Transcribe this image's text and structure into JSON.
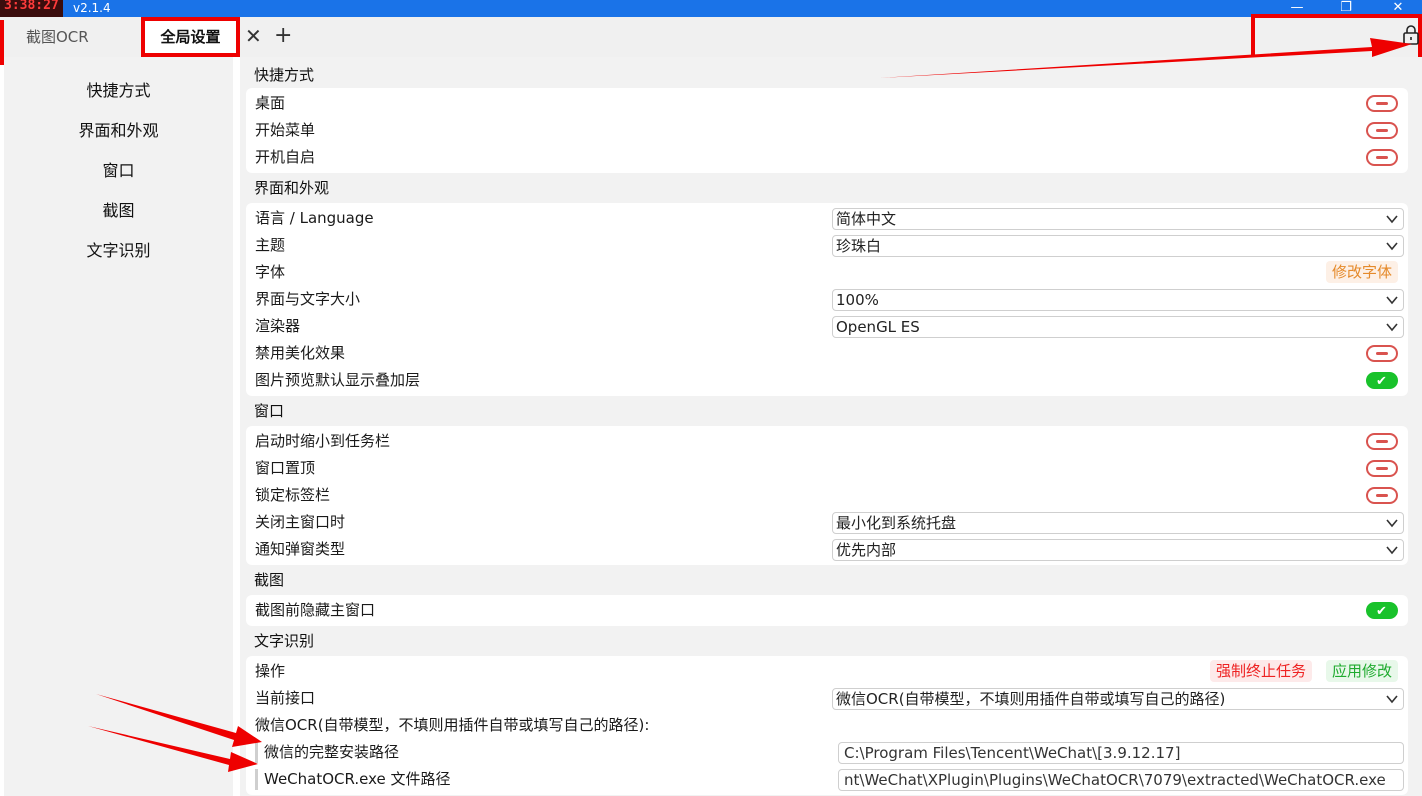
{
  "titlebar": {
    "clock": "3:38:27",
    "version": "v2.1.4",
    "minimize": "—",
    "restore": "❐",
    "close": "✕"
  },
  "tabs": {
    "inactive_label": "截图OCR",
    "active_label": "全局设置",
    "close": "✕",
    "add": "+"
  },
  "sidebar": {
    "items": [
      "快捷方式",
      "界面和外观",
      "窗口",
      "截图",
      "文字识别"
    ]
  },
  "sections": {
    "shortcuts": {
      "title": "快捷方式",
      "desktop": "桌面",
      "start_menu": "开始菜单",
      "autostart": "开机自启"
    },
    "appearance": {
      "title": "界面和外观",
      "language": "语言 / Language",
      "language_value": "简体中文",
      "theme": "主题",
      "theme_value": "珍珠白",
      "font": "字体",
      "font_button": "修改字体",
      "scale": "界面与文字大小",
      "scale_value": "100%",
      "renderer": "渲染器",
      "renderer_value": "OpenGL ES",
      "disable_effects": "禁用美化效果",
      "overlay": "图片预览默认显示叠加层"
    },
    "window": {
      "title": "窗口",
      "minimize_start": "启动时缩小到任务栏",
      "always_top": "窗口置顶",
      "lock_tabs": "锁定标签栏",
      "on_close": "关闭主窗口时",
      "on_close_value": "最小化到系统托盘",
      "notify_type": "通知弹窗类型",
      "notify_value": "优先内部"
    },
    "screenshot": {
      "title": "截图",
      "hide_main": "截图前隐藏主窗口"
    },
    "ocr": {
      "title": "文字识别",
      "actions": "操作",
      "force_stop": "强制终止任务",
      "apply": "应用修改",
      "api": "当前接口",
      "api_value": "微信OCR(自带模型，不填则用插件自带或填写自己的路径)",
      "group_label": "微信OCR(自带模型，不填则用插件自带或填写自己的路径):",
      "install_path": "微信的完整安装路径",
      "install_path_value": "C:\\Program Files\\Tencent\\WeChat\\[3.9.12.17]",
      "exe_path": "WeChatOCR.exe 文件路径",
      "exe_path_value": "nt\\WeChat\\XPlugin\\Plugins\\WeChatOCR\\7079\\extracted\\WeChatOCR.exe"
    }
  },
  "toggles": {
    "desktop": false,
    "start_menu": false,
    "autostart": false,
    "disable_effects": false,
    "overlay": true,
    "minimize_start": false,
    "always_top": false,
    "lock_tabs": false,
    "hide_main": true
  },
  "colors": {
    "titlebar": "#1a73e8",
    "toggle_off": "#d9534f",
    "toggle_on": "#19c22b",
    "annotation": "#e00000"
  }
}
